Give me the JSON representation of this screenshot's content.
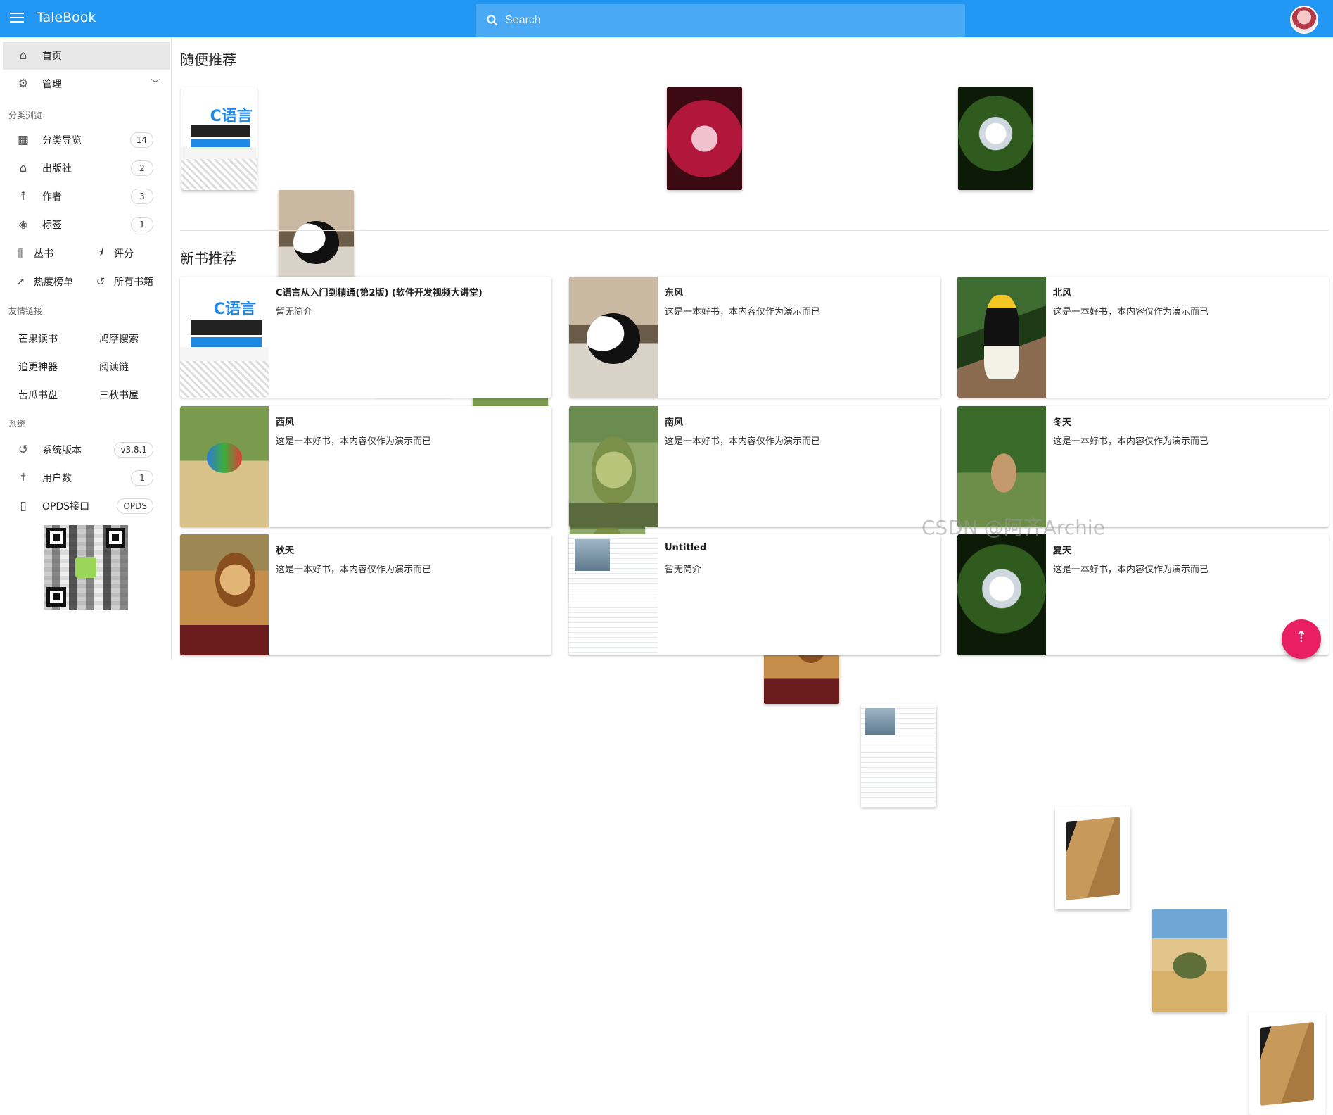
{
  "appbar": {
    "brand": "TaleBook",
    "search_placeholder": "Search"
  },
  "sidebar": {
    "home": "首页",
    "manage": "管理",
    "browse_section": "分类浏览",
    "browse_items": [
      {
        "label": "分类导览",
        "count": "14",
        "icon": "dashboard-icon"
      },
      {
        "label": "出版社",
        "count": "2",
        "icon": "publisher-icon"
      },
      {
        "label": "作者",
        "count": "3",
        "icon": "author-icon"
      },
      {
        "label": "标签",
        "count": "1",
        "icon": "tag-icon"
      }
    ],
    "grid_items": [
      {
        "label": "丛书",
        "icon": "series-icon"
      },
      {
        "label": "评分",
        "icon": "rating-icon"
      },
      {
        "label": "热度榜单",
        "icon": "trending-icon"
      },
      {
        "label": "所有书籍",
        "icon": "history-icon"
      }
    ],
    "links_section": "友情链接",
    "links": [
      "芒果读书",
      "鸠摩搜索",
      "追更神器",
      "阅读链",
      "苦瓜书盘",
      "三秋书屋"
    ],
    "system_section": "系统",
    "system_items": [
      {
        "label": "系统版本",
        "value": "v3.8.1",
        "icon": "version-icon"
      },
      {
        "label": "用户数",
        "value": "1",
        "icon": "user-icon"
      },
      {
        "label": "OPDS接口",
        "value": "OPDS",
        "icon": "phone-icon"
      }
    ]
  },
  "main": {
    "random_title": "随便推荐",
    "random_covers": [
      "c-book",
      "panda",
      "hornbill",
      "lorikeet",
      "kakapo",
      "sundew",
      "lion",
      "document",
      "white-flower",
      "default-book",
      "desert-plant",
      "default-book"
    ],
    "new_title": "新书推荐",
    "new_books": [
      {
        "title": "C语言从入门到精通(第2版) (软件开发视频大讲堂)",
        "desc": "暂无简介",
        "cover": "c-book"
      },
      {
        "title": "东风",
        "desc": "这是一本好书，本内容仅作为演示而已",
        "cover": "panda"
      },
      {
        "title": "北风",
        "desc": "这是一本好书，本内容仅作为演示而已",
        "cover": "hornbill"
      },
      {
        "title": "西风",
        "desc": "这是一本好书，本内容仅作为演示而已",
        "cover": "lorikeet"
      },
      {
        "title": "南风",
        "desc": "这是一本好书，本内容仅作为演示而已",
        "cover": "kakapo"
      },
      {
        "title": "冬天",
        "desc": "这是一本好书，本内容仅作为演示而已",
        "cover": "deer"
      },
      {
        "title": "秋天",
        "desc": "这是一本好书，本内容仅作为演示而已",
        "cover": "lion"
      },
      {
        "title": "Untitled",
        "desc": "暂无简介",
        "cover": "document"
      },
      {
        "title": "夏天",
        "desc": "这是一本好书，本内容仅作为演示而已",
        "cover": "white-flower"
      }
    ]
  },
  "cbook_cover_text": "C语言",
  "watermark": "CSDN @阿齐Archie",
  "colors": {
    "primary": "#2196f3",
    "accent": "#e91e63"
  }
}
